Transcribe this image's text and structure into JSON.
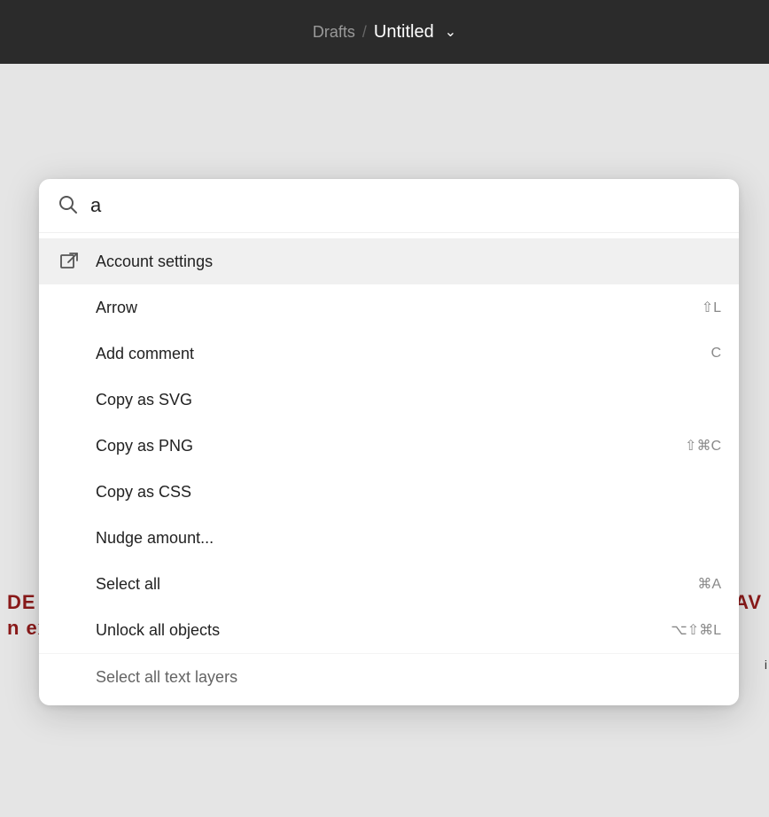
{
  "topbar": {
    "drafts_label": "Drafts",
    "separator": "/",
    "title": "Untitled",
    "chevron": "⌄"
  },
  "background": {
    "left_text_line1": "DE",
    "left_text_line2": "n ex",
    "right_text_line1": "AV",
    "bottom_right_text": "i"
  },
  "search": {
    "icon": "⌕",
    "value": "a",
    "placeholder": ""
  },
  "menu_items": [
    {
      "id": "account-settings",
      "label": "Account settings",
      "icon_type": "external-link",
      "shortcut": "",
      "highlighted": true
    },
    {
      "id": "arrow",
      "label": "Arrow",
      "icon_type": "none",
      "shortcut": "⇧L"
    },
    {
      "id": "add-comment",
      "label": "Add comment",
      "icon_type": "none",
      "shortcut": "C"
    },
    {
      "id": "copy-svg",
      "label": "Copy as SVG",
      "icon_type": "none",
      "shortcut": ""
    },
    {
      "id": "copy-png",
      "label": "Copy as PNG",
      "icon_type": "none",
      "shortcut": "⇧⌘C"
    },
    {
      "id": "copy-css",
      "label": "Copy as CSS",
      "icon_type": "none",
      "shortcut": ""
    },
    {
      "id": "nudge-amount",
      "label": "Nudge amount...",
      "icon_type": "none",
      "shortcut": ""
    },
    {
      "id": "select-all",
      "label": "Select all",
      "icon_type": "none",
      "shortcut": "⌘A"
    },
    {
      "id": "unlock-all",
      "label": "Unlock all objects",
      "icon_type": "none",
      "shortcut": "⌥⇧⌘L"
    },
    {
      "id": "select-text-layers",
      "label": "Select all text layers",
      "icon_type": "none",
      "shortcut": "",
      "partial": true
    }
  ]
}
